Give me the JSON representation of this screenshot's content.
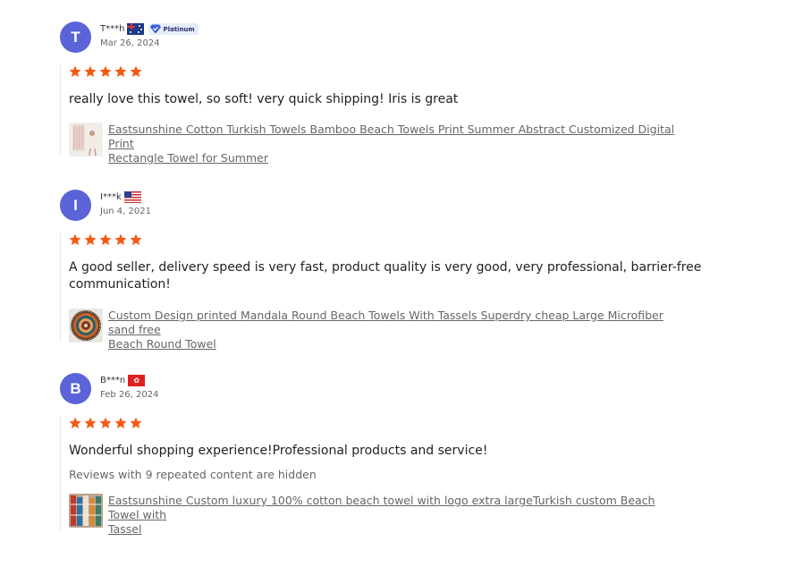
{
  "colors": {
    "avatar": "#5b63d8",
    "star": "#f55a14",
    "link": "#666666"
  },
  "reviews": [
    {
      "initial": "T",
      "name": "T***h",
      "flag": "australia-flag",
      "badge": "Platinum",
      "date": "Mar 26, 2024",
      "rating": 5,
      "text": "really love this towel, so soft! very quick shipping! Iris is great",
      "hidden_note": "",
      "product_line1": "Eastsunshine Cotton Turkish Towels Bamboo Beach Towels Print Summer Abstract Customized Digital Print",
      "product_line2": "Rectangle Towel for Summer"
    },
    {
      "initial": "I",
      "name": "I***k",
      "flag": "usa-flag",
      "badge": "",
      "date": "Jun 4, 2021",
      "rating": 5,
      "text_line1": "A good seller, delivery speed is very fast, product quality is very good, very professional, barrier-free",
      "text_line2": "communication!",
      "hidden_note": "",
      "product_line1": "Custom Design printed Mandala Round Beach Towels With Tassels Superdry cheap Large Microfiber sand free",
      "product_line2": "Beach Round Towel"
    },
    {
      "initial": "B",
      "name": "B***n",
      "flag": "hong-kong-flag",
      "badge": "",
      "date": "Feb 26, 2024",
      "rating": 5,
      "text": "Wonderful shopping experience!Professional products and service!",
      "hidden_note": "Reviews with 9 repeated content are hidden",
      "product_line1": "Eastsunshine Custom luxury 100% cotton beach towel with logo extra largeTurkish custom Beach Towel with",
      "product_line2": "Tassel"
    }
  ]
}
